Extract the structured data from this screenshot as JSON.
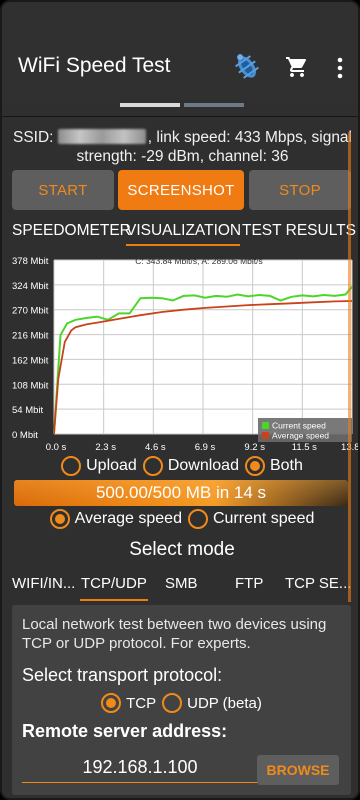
{
  "app": {
    "title": "WiFi Speed Test",
    "icons": [
      "bug-icon",
      "cart-icon",
      "more-vert-icon"
    ]
  },
  "ssid_line": {
    "prefix": "SSID: ",
    "suffix": ", link speed: 433 Mbps, signal strength: -29 dBm, channel: 36"
  },
  "buttons": {
    "start": "START",
    "screenshot": "SCREENSHOT",
    "stop": "STOP"
  },
  "tabs_top": [
    "SPEEDOMETER",
    "VISUALIZATION",
    "TEST RESULTS"
  ],
  "tabs_top_selected": 1,
  "chart_data": {
    "type": "line",
    "title": "C: 343.84 Mbit/s, A: 289.06 Mbit/s",
    "ylim": [
      0,
      378
    ],
    "yticks": [
      "378 Mbit",
      "324 Mbit",
      "270 Mbit",
      "216 Mbit",
      "162 Mbit",
      "108 Mbit",
      "54 Mbit",
      "0 Mbit"
    ],
    "xlim": [
      0,
      13.8
    ],
    "xticks": [
      "0.0 s",
      "2.3 s",
      "4.6 s",
      "6.9 s",
      "9.2 s",
      "11.5 s",
      "13.8 s"
    ],
    "legend_position": "bottom-right",
    "series": [
      {
        "name": "Current speed",
        "color": "#4cd62a",
        "x": [
          0.0,
          0.3,
          0.6,
          1.0,
          1.5,
          2.0,
          2.5,
          3.0,
          3.5,
          4.0,
          4.5,
          5.0,
          5.5,
          6.0,
          6.5,
          7.0,
          7.5,
          8.0,
          8.5,
          9.0,
          9.5,
          10.0,
          10.5,
          11.0,
          11.5,
          12.0,
          12.5,
          13.0,
          13.5,
          13.8
        ],
        "values": [
          0,
          215,
          240,
          248,
          252,
          255,
          248,
          262,
          262,
          295,
          296,
          295,
          290,
          300,
          301,
          296,
          300,
          298,
          303,
          299,
          302,
          300,
          290,
          298,
          301,
          299,
          302,
          300,
          303,
          320
        ]
      },
      {
        "name": "Average speed",
        "color": "#c9421a",
        "x": [
          0.0,
          0.2,
          0.5,
          0.8,
          1.0,
          1.5,
          2.0,
          3.0,
          4.0,
          5.0,
          6.0,
          7.0,
          8.0,
          9.0,
          10.0,
          11.0,
          12.0,
          13.0,
          13.8
        ],
        "values": [
          0,
          120,
          200,
          225,
          232,
          238,
          242,
          250,
          258,
          265,
          270,
          274,
          277,
          280,
          282,
          284,
          286,
          288,
          289
        ]
      }
    ]
  },
  "direction": {
    "options": [
      "Upload",
      "Download",
      "Both"
    ],
    "selected": 2
  },
  "progress": {
    "text": "500.00/500 MB in 14 s",
    "fraction": 1.0
  },
  "speed_mode": {
    "options": [
      "Average speed",
      "Current speed"
    ],
    "selected": 0
  },
  "select_mode": {
    "title": "Select mode",
    "tabs": [
      "WIFI/IN...",
      "TCP/UDP",
      "SMB",
      "FTP",
      "TCP SE..."
    ],
    "selected": 1
  },
  "tcp_panel": {
    "description": "Local network test between two devices using TCP or UDP protocol. For experts.",
    "transport_label": "Select transport protocol:",
    "protocols": [
      "TCP",
      "UDP (beta)"
    ],
    "protocol_selected": 0,
    "server_label": "Remote server address:",
    "server_value": "192.168.1.100",
    "browse_label": "BROWSE"
  },
  "colors": {
    "accent": "#f07b13",
    "background": "#2f2f2f",
    "panel": "#424242",
    "button": "#5e5e5e"
  }
}
